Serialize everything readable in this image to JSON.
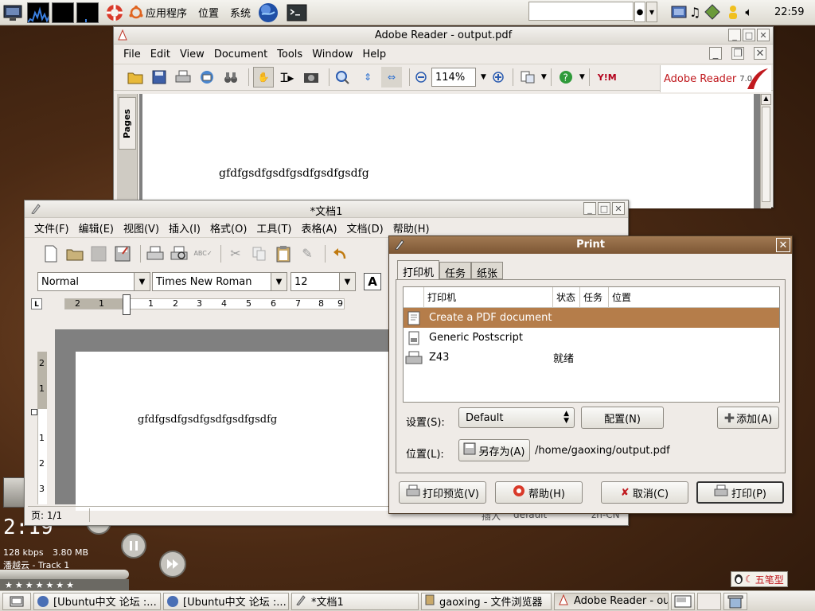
{
  "top_panel": {
    "menus": [
      "应用程序",
      "位置",
      "系统"
    ],
    "clock": "22:59"
  },
  "reader": {
    "title": "Adobe Reader - output.pdf",
    "menus": [
      "File",
      "Edit",
      "View",
      "Document",
      "Tools",
      "Window",
      "Help"
    ],
    "zoom": "114%",
    "brand": "Adobe Reader",
    "brand_version": "7.0",
    "pages_tab": "Pages",
    "doc_text": "gfdfgsdfgsdfgsdfgsdfgsdfg"
  },
  "writer": {
    "title": "*文档1",
    "menus": [
      "文件(F)",
      "编辑(E)",
      "视图(V)",
      "插入(I)",
      "格式(O)",
      "工具(T)",
      "表格(A)",
      "文档(D)",
      "帮助(H)"
    ],
    "style": "Normal",
    "font": "Times New Roman",
    "size": "12",
    "bold_label": "A",
    "ruler": [
      "2",
      "1",
      "1",
      "2",
      "3",
      "4",
      "5",
      "6",
      "7",
      "8",
      "9",
      "10"
    ],
    "vruler": [
      "2",
      "1",
      "1",
      "2",
      "3"
    ],
    "doc_text": "gfdfgsdfgsdfgsdfgsdfgsdfg",
    "status_page": "页: 1/1",
    "status_insert": "插入",
    "status_style": "default",
    "status_lang": "zh-CN"
  },
  "print": {
    "title": "Print",
    "tabs": [
      "打印机",
      "任务",
      "纸张"
    ],
    "columns": [
      "打印机",
      "状态",
      "任务",
      "位置"
    ],
    "printers": [
      {
        "name": "Create a PDF document",
        "status": ""
      },
      {
        "name": "Generic Postscript",
        "status": ""
      },
      {
        "name": "Z43",
        "status": "就绪"
      }
    ],
    "settings_label": "设置(S):",
    "settings_value": "Default",
    "configure": "配置(N)",
    "add": "添加(A)",
    "location_label": "位置(L):",
    "save_as": "另存为(A)",
    "location_path": "/home/gaoxing/output.pdf",
    "preview": "打印预览(V)",
    "help": "帮助(H)",
    "cancel": "取消(C)",
    "print": "打印(P)"
  },
  "player": {
    "time": "2:19",
    "bitrate": "128 kbps",
    "filesize": "3.80 MB",
    "track": "潘越云 - Track 1"
  },
  "ime": {
    "label": "五笔型"
  },
  "taskbar": {
    "tasks": [
      "[Ubuntu中文 论坛 :...",
      "[Ubuntu中文 论坛 :...",
      "*文档1",
      "gaoxing - 文件浏览器",
      "Adobe Reader - ou..."
    ]
  }
}
